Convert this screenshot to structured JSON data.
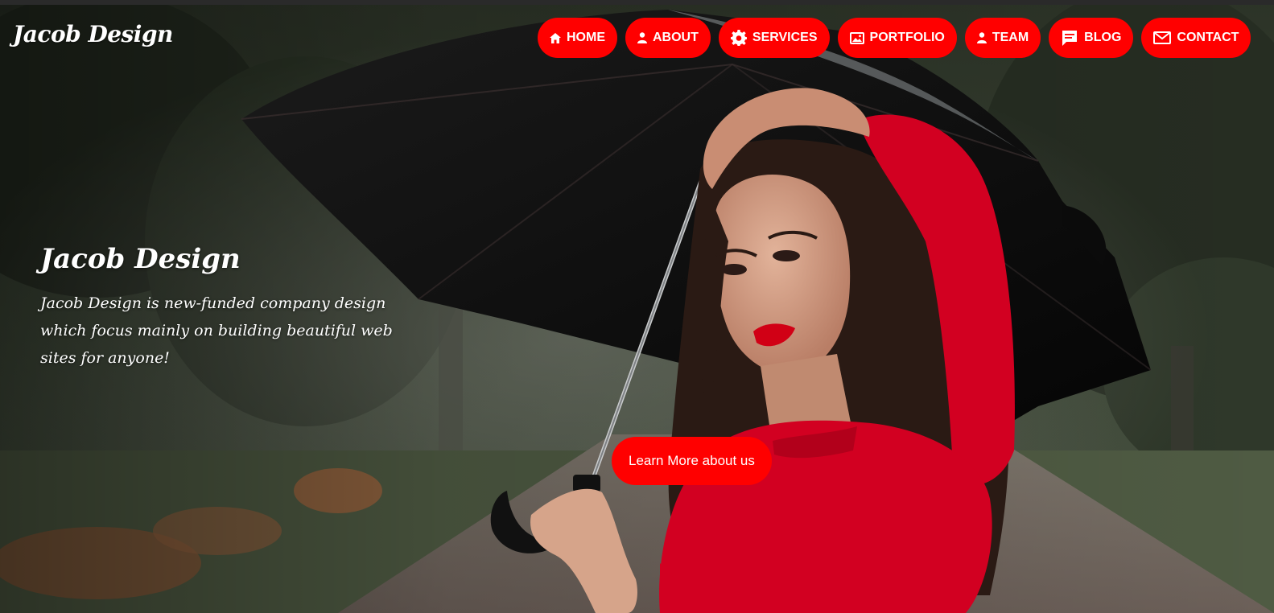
{
  "brand": {
    "logo_text": "Jacob Design"
  },
  "nav": {
    "items": [
      {
        "label": "HOME",
        "icon": "home-icon"
      },
      {
        "label": "ABOUT",
        "icon": "user-icon"
      },
      {
        "label": "SERVICES",
        "icon": "gear-icon"
      },
      {
        "label": "PORTFOLIO",
        "icon": "image-icon"
      },
      {
        "label": "TEAM",
        "icon": "user-icon"
      },
      {
        "label": "BLOG",
        "icon": "chat-icon"
      },
      {
        "label": "CONTACT",
        "icon": "mail-icon"
      }
    ]
  },
  "hero": {
    "title": "Jacob Design",
    "description": "Jacob Design is new-funded company design which focus mainly on building beautiful web sites for anyone!",
    "cta_label": "Learn More about us",
    "background_image": "woman-with-umbrella-photo"
  },
  "colors": {
    "accent": "#ff0000",
    "text": "#ffffff"
  }
}
